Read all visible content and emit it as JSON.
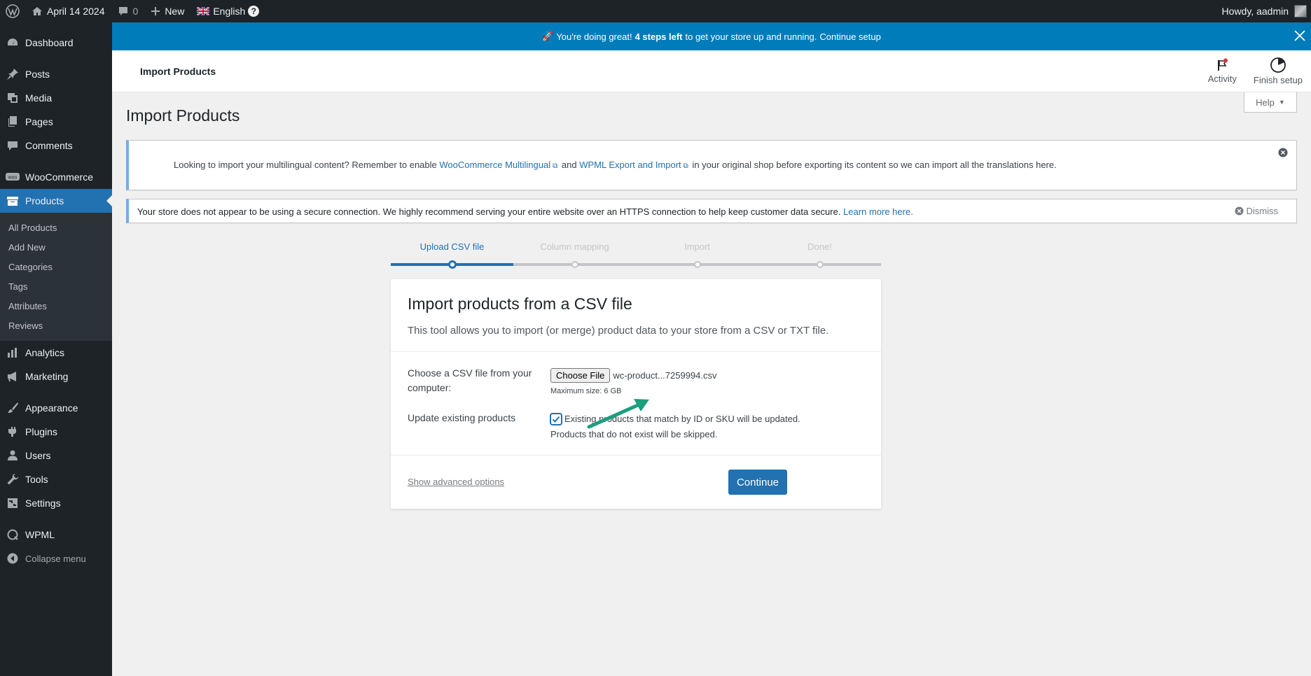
{
  "admin_bar": {
    "site_name": "April 14 2024",
    "comments_count": "0",
    "new_label": "New",
    "language": "English",
    "language_help": "?",
    "greeting": "Howdy, aadmin"
  },
  "sidebar": {
    "items": [
      {
        "label": "Dashboard",
        "icon": "dashboard-icon"
      },
      {
        "label": "Posts",
        "icon": "pin-icon"
      },
      {
        "label": "Media",
        "icon": "media-icon"
      },
      {
        "label": "Pages",
        "icon": "pages-icon"
      },
      {
        "label": "Comments",
        "icon": "comment-icon"
      },
      {
        "label": "WooCommerce",
        "icon": "woo-icon"
      },
      {
        "label": "Products",
        "icon": "archive-icon"
      },
      {
        "label": "Analytics",
        "icon": "chart-icon"
      },
      {
        "label": "Marketing",
        "icon": "megaphone-icon"
      },
      {
        "label": "Appearance",
        "icon": "brush-icon"
      },
      {
        "label": "Plugins",
        "icon": "plug-icon"
      },
      {
        "label": "Users",
        "icon": "user-icon"
      },
      {
        "label": "Tools",
        "icon": "wrench-icon"
      },
      {
        "label": "Settings",
        "icon": "settings-icon"
      },
      {
        "label": "WPML",
        "icon": "wpml-icon"
      }
    ],
    "submenu": [
      "All Products",
      "Add New",
      "Categories",
      "Tags",
      "Attributes",
      "Reviews"
    ],
    "collapse_label": "Collapse menu"
  },
  "setup_notice": {
    "emoji": "🚀",
    "prefix": "You're doing great!",
    "bold": "4 steps left",
    "suffix": "to get your store up and running.",
    "link": "Continue setup"
  },
  "header": {
    "title": "Import Products",
    "activity_label": "Activity",
    "finish_label": "Finish setup"
  },
  "help_tab": "Help",
  "page_title": "Import Products",
  "wpml_notice": {
    "text1": "Looking to import your multilingual content? Remember to enable",
    "link1": "WooCommerce Multilingual",
    "text2": "and",
    "link2": "WPML Export and Import",
    "text3": "in your original shop before exporting its content so we can import all the translations here."
  },
  "ssl_notice": {
    "text": "Your store does not appear to be using a secure connection. We highly recommend serving your entire website over an HTTPS connection to help keep customer data secure.",
    "link": "Learn more here.",
    "dismiss": "Dismiss"
  },
  "steps": [
    "Upload CSV file",
    "Column mapping",
    "Import",
    "Done!"
  ],
  "card": {
    "title": "Import products from a CSV file",
    "description": "This tool allows you to import (or merge) product data to your store from a CSV or TXT file.",
    "file_label": "Choose a CSV file from your computer:",
    "choose_file_button": "Choose File",
    "file_name": "wc-product...7259994.csv",
    "max_size": "Maximum size: 6 GB",
    "update_label": "Update existing products",
    "update_checked": true,
    "update_text": "Existing products that match by ID or SKU will be updated. Products that do not exist will be skipped.",
    "advanced_link": "Show advanced options",
    "continue_button": "Continue"
  },
  "colors": {
    "admin_dark": "#1d2327",
    "accent": "#2271b1",
    "setup_bar": "#007cba",
    "annotation_arrow": "#1a9e7e"
  }
}
